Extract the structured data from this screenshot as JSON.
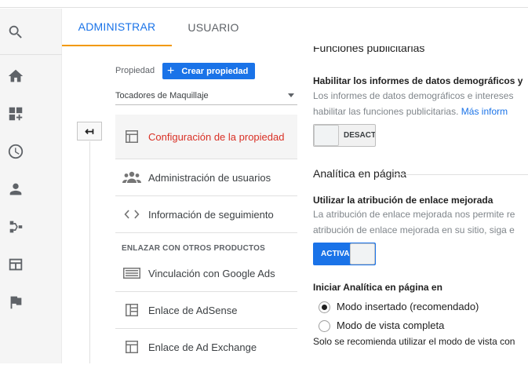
{
  "tabs": {
    "admin": "ADMINISTRAR",
    "user": "USUARIO"
  },
  "rail": {
    "icons": [
      "search-icon",
      "home-icon",
      "dashboard-add-icon",
      "clock-icon",
      "person-icon",
      "fork-icon",
      "browser-icon",
      "flag-icon"
    ]
  },
  "property": {
    "label": "Propiedad",
    "create_label": "Crear propiedad",
    "selected": "Tocadores de Maquillaje"
  },
  "nav": {
    "back_glyph": "↤",
    "items": [
      {
        "label": "Configuración de la propiedad",
        "icon": "layout-icon",
        "active": true
      },
      {
        "label": "Administración de usuarios",
        "icon": "people-icon"
      },
      {
        "label": "Información de seguimiento",
        "icon": "code-icon"
      }
    ],
    "section_title": "ENLAZAR CON OTROS PRODUCTOS",
    "links": [
      {
        "label": "Vinculación con Google Ads",
        "icon": "ads-icon"
      },
      {
        "label": "Enlace de AdSense",
        "icon": "adsense-icon"
      },
      {
        "label": "Enlace de Ad Exchange",
        "icon": "adexchange-icon"
      }
    ]
  },
  "settings": {
    "cut_heading": "Funciones publicitarias",
    "demographics": {
      "title": "Habilitar los informes de datos demográficos y",
      "desc_1": "Los informes de datos demográficos e intereses",
      "desc_2": "habilitar las funciones publicitarias.",
      "more_link": "Más inform",
      "toggle": "DESACT"
    },
    "inpage": {
      "section_title": "Analítica en página",
      "attribution_title": "Utilizar la atribución de enlace mejorada",
      "attribution_desc_1": "La atribución de enlace mejorada nos permite re",
      "attribution_desc_2": "atribución de enlace mejorada en su sitio, siga e",
      "toggle": "ACTIVA",
      "start_title": "Iniciar Analítica en página en",
      "option_embedded": "Modo insertado (recomendado)",
      "option_full": "Modo de vista completa",
      "note": "Solo se recomienda utilizar el modo de vista con"
    }
  },
  "colors": {
    "accent": "#1a73e8",
    "active_text": "#d93025",
    "tab_indicator": "#f29900"
  }
}
